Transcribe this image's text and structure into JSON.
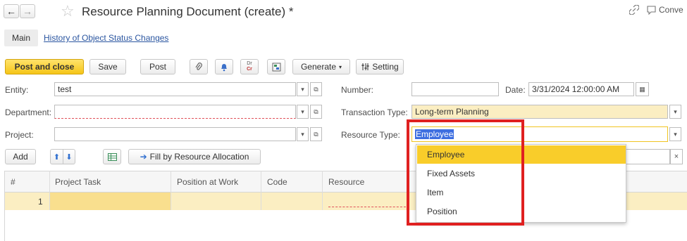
{
  "titlebar": {
    "title": "Resource Planning Document (create) *",
    "back_icon": "←",
    "forward_icon": "→",
    "star_icon": "☆",
    "link_icon": "🔗",
    "chat_label": "Conve"
  },
  "tabs": [
    {
      "label": "Main"
    },
    {
      "label": "History of Object Status Changes"
    }
  ],
  "toolbar": {
    "post_and_close": "Post and close",
    "save": "Save",
    "post": "Post",
    "dr": "Dr",
    "cr": "Cr",
    "generate": "Generate",
    "setting": "Setting"
  },
  "form": {
    "entity_label": "Entity:",
    "entity_value": "test",
    "department_label": "Department:",
    "department_value": "",
    "project_label": "Project:",
    "project_value": "",
    "number_label": "Number:",
    "number_value": "",
    "date_label": "Date:",
    "date_value": "3/31/2024 12:00:00 AM",
    "transaction_type_label": "Transaction Type:",
    "transaction_type_value": "Long-term Planning",
    "resource_type_label": "Resource Type:",
    "resource_type_value": "Employee"
  },
  "table_toolbar": {
    "add": "Add",
    "fill_by_resource_allocation": "Fill by Resource Allocation"
  },
  "table": {
    "columns": [
      "#",
      "Project Task",
      "Position at Work",
      "Code",
      "Resource"
    ],
    "rows": [
      {
        "num": "1",
        "project_task": "",
        "position_at_work": "",
        "code": "",
        "resource": ""
      }
    ]
  },
  "dropdown": {
    "options": [
      "Employee",
      "Fixed Assets",
      "Item",
      "Position"
    ],
    "selected": "Employee"
  },
  "colors": {
    "accent_yellow": "#f9cd2a",
    "row_highlight": "#fbeec2",
    "highlight_frame": "#e02020",
    "selection_blue": "#3d6ee0"
  }
}
